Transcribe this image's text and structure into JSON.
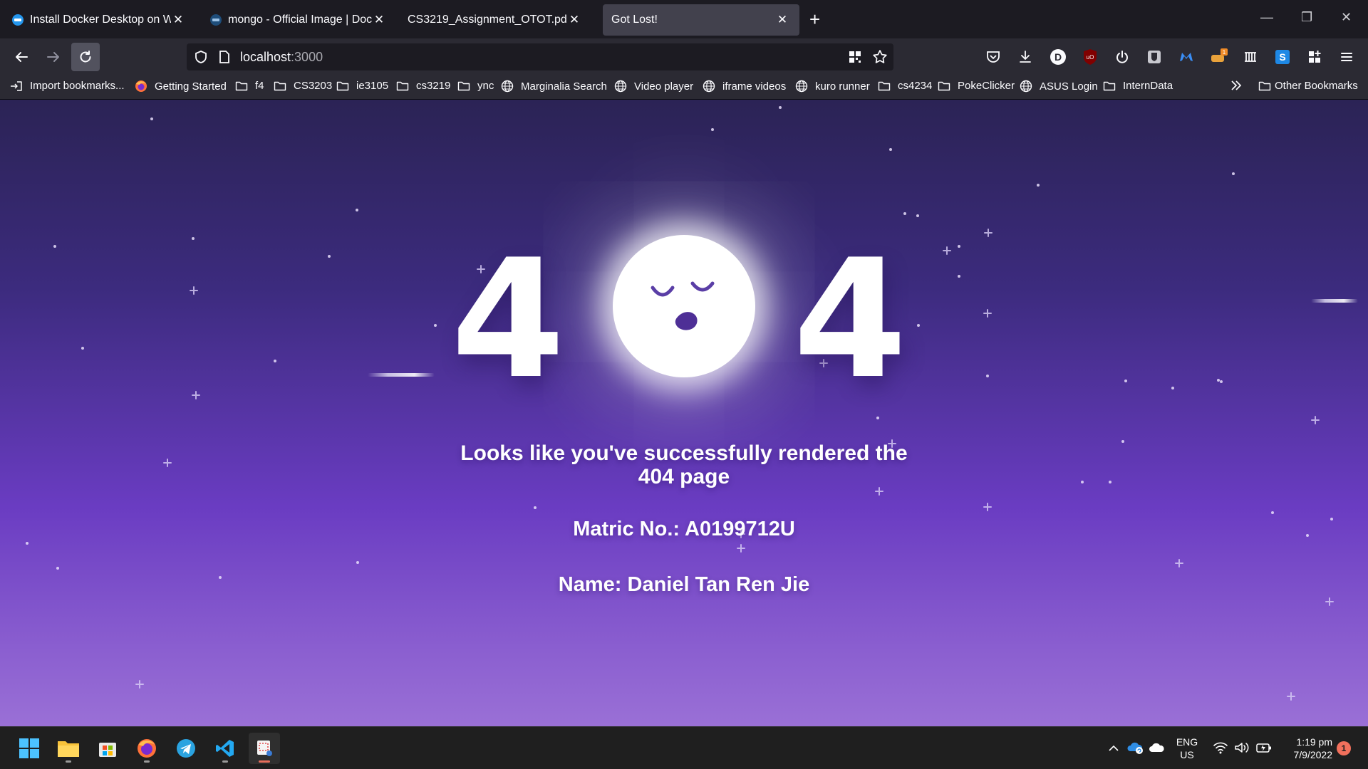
{
  "tabs": [
    {
      "title": "Install Docker Desktop on Windows",
      "favicon": "docker-icon"
    },
    {
      "title": "mongo - Official Image | Docker Hub",
      "favicon": "docker-icon"
    },
    {
      "title": "CS3219_Assignment_OTOT.pdf",
      "favicon": "pdf-icon"
    },
    {
      "title": "Got Lost!",
      "favicon": "none",
      "active": true
    }
  ],
  "window_controls": {
    "minimize": "—",
    "restore": "❐",
    "close": "✕"
  },
  "address": {
    "host": "localhost",
    "port": ":3000"
  },
  "toolbar_icons": [
    "pocket-icon",
    "downloads-icon",
    "extension-d-icon",
    "ublock-icon",
    "power-icon",
    "bitwarden-icon",
    "malwarebytes-icon",
    "extension-badge-icon",
    "extension-grid-icon",
    "extension-s-icon",
    "extensions-icon",
    "menu-icon"
  ],
  "toolbar_badge": "1",
  "bookmarks": [
    {
      "label": "Import bookmarks...",
      "icon": "import-icon"
    },
    {
      "label": "Getting Started",
      "icon": "firefox-icon"
    },
    {
      "label": "f4",
      "icon": "folder-icon"
    },
    {
      "label": "CS3203",
      "icon": "folder-icon"
    },
    {
      "label": "ie3105",
      "icon": "folder-icon"
    },
    {
      "label": "cs3219",
      "icon": "folder-icon"
    },
    {
      "label": "ync",
      "icon": "folder-icon"
    },
    {
      "label": "Marginalia Search",
      "icon": "globe-icon"
    },
    {
      "label": "Video player",
      "icon": "globe-icon"
    },
    {
      "label": "iframe videos",
      "icon": "globe-icon"
    },
    {
      "label": "kuro runner",
      "icon": "globe-icon"
    },
    {
      "label": "cs4234",
      "icon": "folder-icon"
    },
    {
      "label": "PokeClicker",
      "icon": "folder-icon"
    },
    {
      "label": "ASUS Login",
      "icon": "globe-icon"
    },
    {
      "label": "InternData",
      "icon": "folder-icon"
    }
  ],
  "other_bookmarks": "Other Bookmarks",
  "page": {
    "digit_left": "4",
    "digit_right": "4",
    "message": "Looks like you've successfully rendered the 404 page",
    "matric": "Matric No.: A0199712U",
    "name": "Name: Daniel Tan Ren Jie"
  },
  "taskbar": {
    "apps": [
      "windows-start-icon",
      "file-explorer-icon",
      "microsoft-store-icon",
      "firefox-icon",
      "telegram-icon",
      "vscode-icon",
      "snipping-tool-icon"
    ],
    "lang_line1": "ENG",
    "lang_line2": "US",
    "time": "1:19 pm",
    "date": "7/9/2022",
    "notification_count": "1"
  },
  "colors": {
    "accent": "#6a3cc2",
    "tab_active": "#42414d",
    "toolbar": "#2b2a33"
  }
}
